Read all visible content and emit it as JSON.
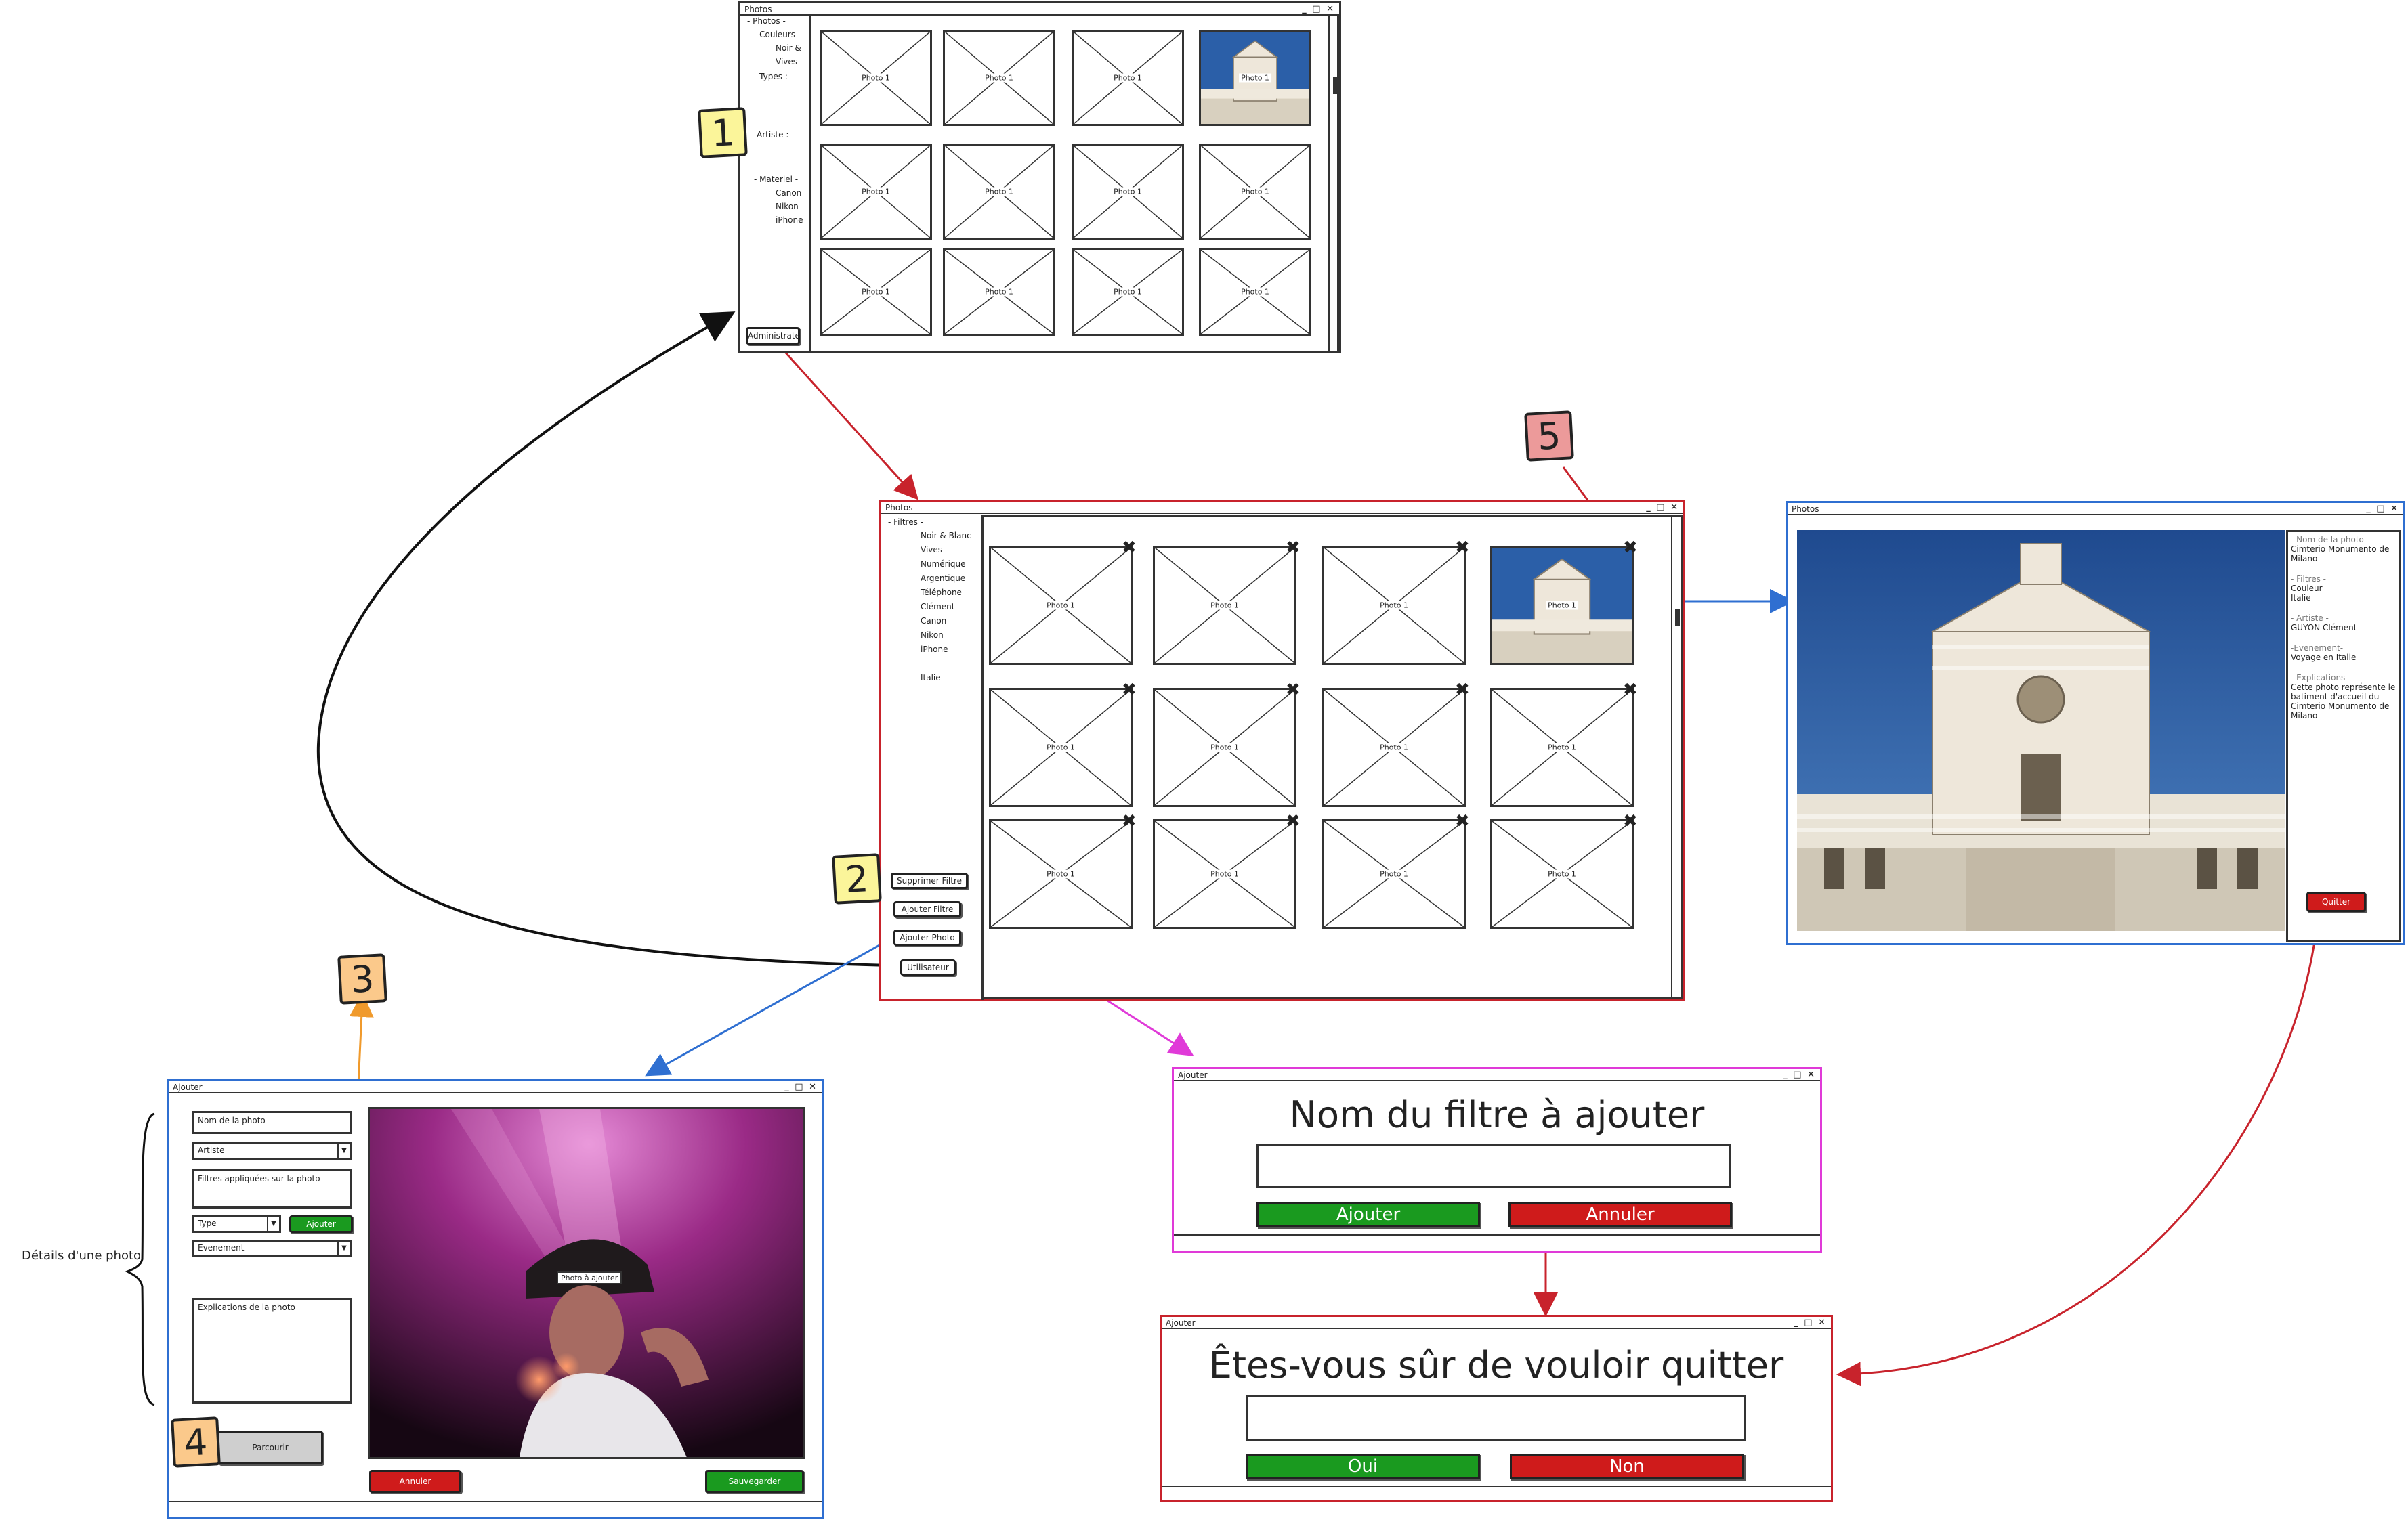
{
  "colors": {
    "sticky_yellow": "#fbf59a",
    "sticky_orange": "#fbc98b",
    "sticky_red": "#ec9a9a",
    "arrow_red": "#c8232c",
    "arrow_blue": "#2f6fd1",
    "arrow_pink": "#e03ad8",
    "arrow_orange": "#f09a2c",
    "btn_green": "#1a9a1f",
    "btn_red": "#cf1b1b"
  },
  "stickies": {
    "s1": "1",
    "s2": "2",
    "s3": "3",
    "s4": "4",
    "s5": "5"
  },
  "window1": {
    "title": "Photos",
    "controls": "_ □ ✕",
    "sidebar": {
      "photos": "- Photos -",
      "couleurs": "- Couleurs -",
      "noir": "Noir &",
      "vives": "Vives",
      "types": "- Types : -",
      "artiste": "Artiste : -",
      "materiel": "- Materiel -",
      "canon": "Canon",
      "nikon": "Nikon",
      "iphone": "iPhone"
    },
    "admin_button": "Administrate",
    "thumb_label": "Photo 1"
  },
  "window2": {
    "title": "Photos",
    "controls": "_ □ ✕",
    "filters_title": "- Filtres -",
    "filters": [
      "Noir & Blanc",
      "Vives",
      "Numérique",
      "Argentique",
      "Téléphone",
      "Clément",
      "Canon",
      "Nikon",
      "iPhone",
      "",
      "Italie"
    ],
    "btn_supprimer": "Supprimer Filtre",
    "btn_ajouter_filtre": "Ajouter Filtre",
    "btn_ajouter_photo": "Ajouter Photo",
    "btn_utilisateur": "Utilisateur",
    "thumb_label": "Photo 1",
    "delete_icon": "✖"
  },
  "window3": {
    "title": "Photos",
    "controls": "_ □ ✕",
    "details": {
      "nom_label": "- Nom de la photo -",
      "nom_value": "Cimterio Monumento de Milano",
      "filtres_label": "- Filtres -",
      "filtres_value": "Couleur\nItalie",
      "artiste_label": "- Artiste -",
      "artiste_value": "GUYON Clément",
      "evenement_label": "-Evenement-",
      "evenement_value": "Voyage en Italie",
      "explications_label": "- Explications -",
      "explications_value": "Cette photo représente le batiment d'accueil du Cimterio Monumento de Milano"
    },
    "quit_button": "Quitter"
  },
  "window4": {
    "title": "Ajouter",
    "controls": "_ □ ✕",
    "nom_placeholder": "Nom de la photo",
    "artiste_select": "Artiste",
    "filtres_placeholder": "Filtres appliquées sur la photo",
    "type_select": "Type",
    "ajouter_button": "Ajouter",
    "evenement_select": "Evenement",
    "explications_placeholder": "Explications de la photo",
    "parcourir_button": "Parcourir",
    "photo_label": "Photo à ajouter",
    "annuler_button": "Annuler",
    "sauvegarder_button": "Sauvegarder"
  },
  "details_annotation": "Détails d'une photo",
  "dialog1": {
    "title": "Ajouter",
    "controls": "_ □ ✕",
    "heading": "Nom du filtre à ajouter",
    "ok": "Ajouter",
    "cancel": "Annuler"
  },
  "dialog2": {
    "title": "Ajouter",
    "controls": "_ □ ✕",
    "heading": "Êtes-vous sûr de vouloir quitter",
    "ok": "Oui",
    "cancel": "Non"
  }
}
